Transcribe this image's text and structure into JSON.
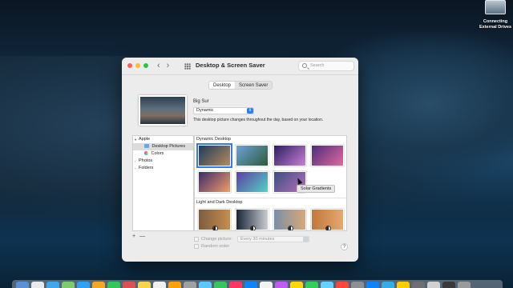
{
  "desktop": {
    "drive_label_line1": "Connecting",
    "drive_label_line2": "External Drives"
  },
  "window": {
    "title": "Desktop & Screen Saver",
    "search_placeholder": "Search",
    "tabs": [
      "Desktop",
      "Screen Saver"
    ],
    "active_tab": "Desktop",
    "picture": {
      "name": "Big Sur",
      "mode": "Dynamic",
      "description": "This desktop picture changes throughout the day, based on your location."
    },
    "sidebar": {
      "apple_label": "Apple",
      "items": [
        {
          "label": "Desktop Pictures"
        },
        {
          "label": "Colors"
        }
      ],
      "photos_label": "Photos",
      "folders_label": "Folders"
    },
    "sections": {
      "dynamic_title": "Dynamic Desktop",
      "light_dark_title": "Light and Dark Desktop"
    },
    "dynamic_thumbs": [
      {
        "colors": [
          "#1e3b5c",
          "#b58a5a"
        ],
        "selected": true
      },
      {
        "colors": [
          "#6da2d9",
          "#2b5b3a"
        ]
      },
      {
        "colors": [
          "#2a1f5e",
          "#c97fd9"
        ]
      },
      {
        "colors": [
          "#4b2c7a",
          "#e06aa0"
        ]
      },
      {
        "colors": [
          "#3b2a6b",
          "#f09e67"
        ]
      },
      {
        "colors": [
          "#5b3ea6",
          "#54d1c2"
        ]
      },
      {
        "colors": [
          "#3d4f7b",
          "#b36fbf"
        ]
      }
    ],
    "tooltip": "Solar Gradients",
    "light_dark_thumbs": [
      {
        "colors": [
          "#7d5d40",
          "#c98c4e"
        ]
      },
      {
        "colors": [
          "#1b2638",
          "#c9ccd2"
        ]
      },
      {
        "colors": [
          "#7a8fa8",
          "#d8a878"
        ]
      },
      {
        "colors": [
          "#c4773a",
          "#e5a86f"
        ]
      }
    ],
    "add_symbol": "+",
    "remove_symbol": "—",
    "change_picture_label": "Change picture:",
    "change_interval": "Every 30 minutes",
    "random_order_label": "Random order",
    "help_symbol": "?"
  },
  "dock": {
    "icon_colors": [
      "#5b8fd6",
      "#e9e9e9",
      "#3fa7ee",
      "#7ecb6a",
      "#2ea1f5",
      "#f5a623",
      "#33c759",
      "#e04f4f",
      "#f7d54a",
      "#f0f0f0",
      "#ff9f0a",
      "#a0a0a0",
      "#5ac8fa",
      "#34c759",
      "#ff375f",
      "#0a84ff",
      "#f2f2f2",
      "#bf5af2",
      "#ffd60a",
      "#30d158",
      "#64d2ff",
      "#ff453a",
      "#8e8e93",
      "#0a84ff",
      "#32ade6",
      "#ffcc00",
      "#6e6e73",
      "#d0d0d0",
      "#3a3a3c",
      "#9a9a9a"
    ]
  }
}
